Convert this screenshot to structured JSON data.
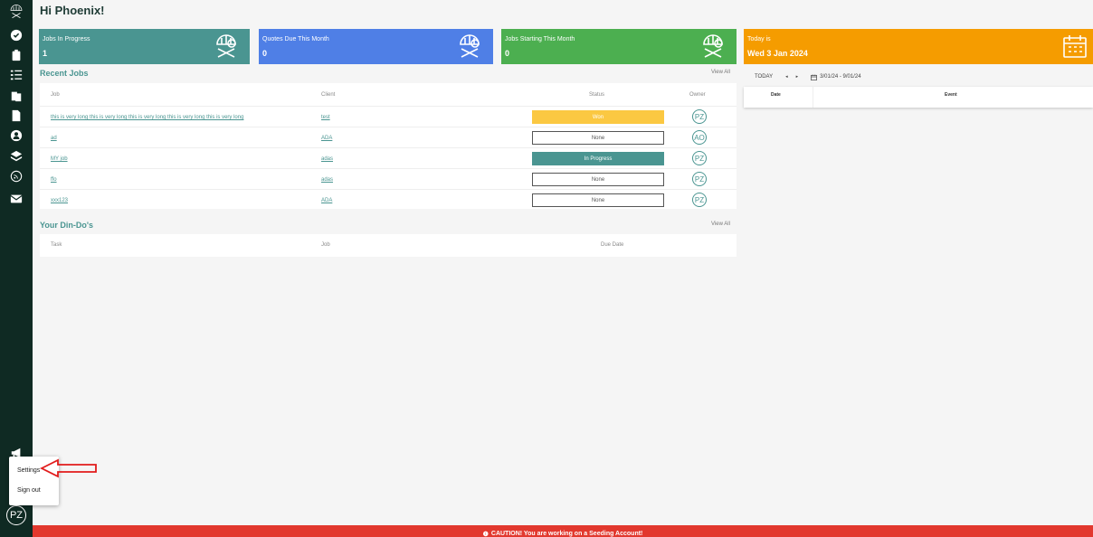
{
  "header": {
    "greeting": "Hi Phoenix!"
  },
  "cards": [
    {
      "label": "Jobs In Progress",
      "value": "1",
      "color": "#4a9591"
    },
    {
      "label": "Quotes Due This Month",
      "value": "0",
      "color": "#4f7fe6"
    },
    {
      "label": "Jobs Starting This Month",
      "value": "0",
      "color": "#4caf50"
    },
    {
      "label": "Today is",
      "value": "Wed 3 Jan 2024",
      "color": "#f59c00"
    }
  ],
  "recent_jobs": {
    "title": "Recent Jobs",
    "view_all": "View All",
    "columns": {
      "job": "Job",
      "client": "Client",
      "status": "Status",
      "owner": "Owner"
    },
    "rows": [
      {
        "job": "this is very long this is very long this is very long this is very long this is very long",
        "client": "test",
        "status": "Won",
        "owner": "PZ"
      },
      {
        "job": "ad",
        "client": "ADA",
        "status": "None",
        "owner": "AO"
      },
      {
        "job": "MY job",
        "client": "adas",
        "status": "In Progress",
        "owner": "PZ"
      },
      {
        "job": "ffo",
        "client": "adas",
        "status": "None",
        "owner": "PZ"
      },
      {
        "job": "xxx123",
        "client": "ADA",
        "status": "None",
        "owner": "PZ"
      }
    ]
  },
  "dindos": {
    "title": "Your Din-Do's",
    "view_all": "View All",
    "columns": {
      "task": "Task",
      "job": "Job",
      "due_date": "Due Date"
    }
  },
  "calendar": {
    "today_button": "TODAY",
    "prev": "◂",
    "next": "▸",
    "range": "3/01/24 - 9/01/24",
    "columns": {
      "date": "Date",
      "event": "Event"
    }
  },
  "popup": {
    "settings": "Settings",
    "sign_out": "Sign out"
  },
  "user": {
    "initials": "PZ"
  },
  "banner": {
    "icon": "❶",
    "text": "CAUTION! You are working on a Seeding Account!"
  },
  "colors": {
    "sidebar": "#0f2a23",
    "accent": "#4a9591",
    "won": "#fbc842",
    "in_progress": "#4a9591",
    "banner": "#e2382e",
    "arrow": "#e11b1b"
  }
}
